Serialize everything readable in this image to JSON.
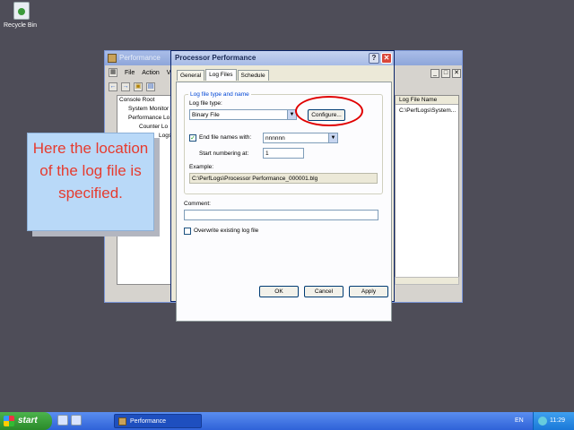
{
  "desktop": {
    "recycle_bin_label": "Recycle Bin"
  },
  "perf_window": {
    "title": "Performance",
    "menu": [
      "File",
      "Action",
      "Vi"
    ],
    "tree": [
      "Console Root",
      "System Monitor",
      "Performance Lo",
      "Counter Lo",
      "Logs"
    ],
    "right_header": "Log File Name",
    "right_cell": "C:\\PerfLogs\\System..."
  },
  "dialog": {
    "title": "Processor Performance",
    "help": "?",
    "close": "✕",
    "tabs": [
      "General",
      "Log Files",
      "Schedule"
    ],
    "group_label": "Log file type and name",
    "log_file_type_label": "Log file type:",
    "log_file_type_value": "Binary File",
    "configure_label": "Configure...",
    "end_names_label": "End file names with:",
    "end_names_value": "nnnnnn",
    "start_numbering_label": "Start numbering at:",
    "start_numbering_value": "1",
    "example_label": "Example:",
    "example_value": "C:\\PerfLogs\\Processor Performance_000001.blg",
    "comment_label": "Comment:",
    "comment_value": "",
    "overwrite_label": "Overwrite existing log file",
    "ok_label": "OK",
    "cancel_label": "Cancel",
    "apply_label": "Apply"
  },
  "callout": {
    "text": "Here the location of the log file is specified."
  },
  "taskbar": {
    "start_label": "start",
    "task_label": "Performance",
    "language": "EN",
    "clock": "11:29"
  },
  "colors": {
    "highlight": "#e00000",
    "callout_bg": "#b9d9f8",
    "callout_text": "#e63b2e"
  }
}
